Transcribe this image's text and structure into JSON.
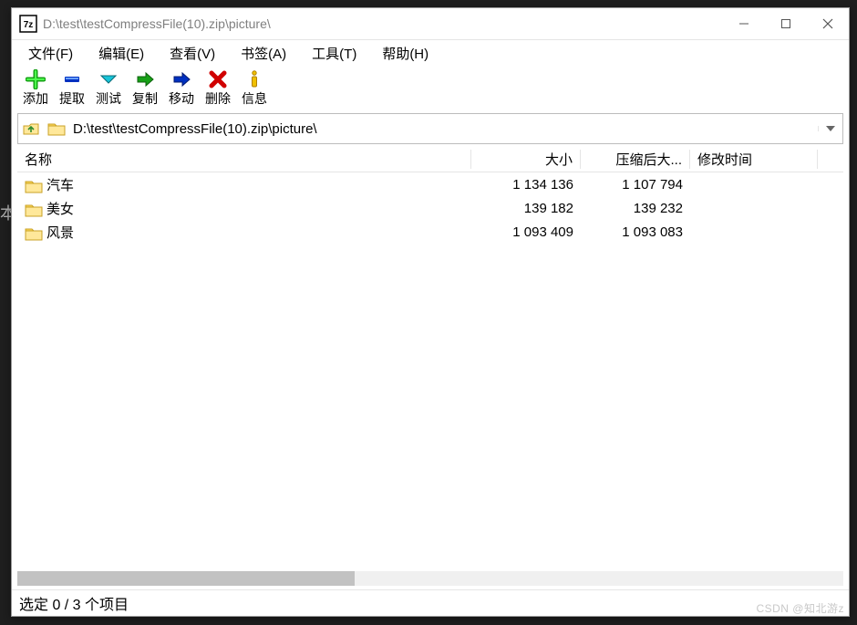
{
  "window": {
    "title": "D:\\test\\testCompressFile(10).zip\\picture\\"
  },
  "menu": {
    "file": "文件(F)",
    "edit": "编辑(E)",
    "view": "查看(V)",
    "bookmarks": "书签(A)",
    "tools": "工具(T)",
    "help": "帮助(H)"
  },
  "toolbar": {
    "add": "添加",
    "extract": "提取",
    "test": "测试",
    "copy": "复制",
    "move": "移动",
    "delete": "删除",
    "info": "信息"
  },
  "path": {
    "value": "D:\\test\\testCompressFile(10).zip\\picture\\"
  },
  "columns": {
    "name": "名称",
    "size": "大小",
    "packed": "压缩后大...",
    "modified": "修改时间"
  },
  "rows": [
    {
      "name": "汽车",
      "size": "1 134 136",
      "packed": "1 107 794",
      "modified": ""
    },
    {
      "name": "美女",
      "size": "139 182",
      "packed": "139 232",
      "modified": ""
    },
    {
      "name": "风景",
      "size": "1 093 409",
      "packed": "1 093 083",
      "modified": ""
    }
  ],
  "status": {
    "text": "选定 0 / 3 个项目"
  },
  "watermark": "CSDN @知北游z",
  "bg": {
    "hint": "本"
  }
}
